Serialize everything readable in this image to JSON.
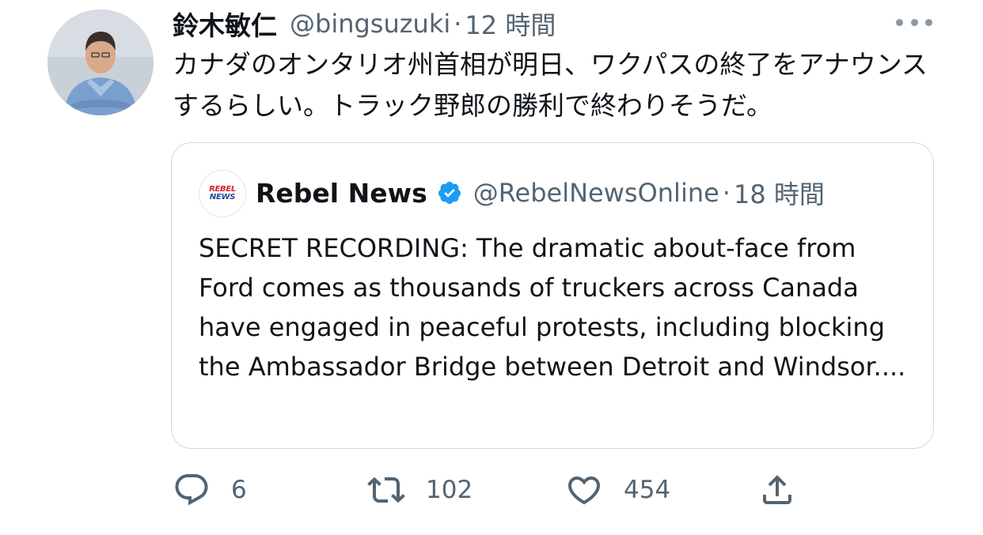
{
  "tweet": {
    "author": {
      "display_name": "鈴木敏仁",
      "handle": "@bingsuzuki",
      "time": "12 時間"
    },
    "separator": "·",
    "text": "カナダのオンタリオ州首相が明日、ワクパスの終了をアナウンスするらしい。トラック野郎の勝利で終わりそうだ。"
  },
  "quote": {
    "avatar_logo": {
      "line1": "REBEL",
      "line2": "NEWS"
    },
    "author": {
      "display_name": "Rebel News",
      "verified": true,
      "handle": "@RebelNewsOnline",
      "time": "18 時間"
    },
    "separator": "·",
    "text": "SECRET RECORDING: The dramatic about-face from Ford comes as thousands of truckers across Canada have engaged in peaceful protests, including blocking the Ambassador Bridge between Detroit and Windsor...."
  },
  "actions": {
    "reply": {
      "icon": "reply-icon",
      "count": "6"
    },
    "retweet": {
      "icon": "retweet-icon",
      "count": "102"
    },
    "like": {
      "icon": "heart-icon",
      "count": "454"
    },
    "share": {
      "icon": "share-icon"
    }
  },
  "colors": {
    "text_primary": "#0f1419",
    "text_secondary": "#536471",
    "border": "#cfd9de",
    "verified_blue": "#1d9bf0",
    "icon_gray": "#536471"
  }
}
